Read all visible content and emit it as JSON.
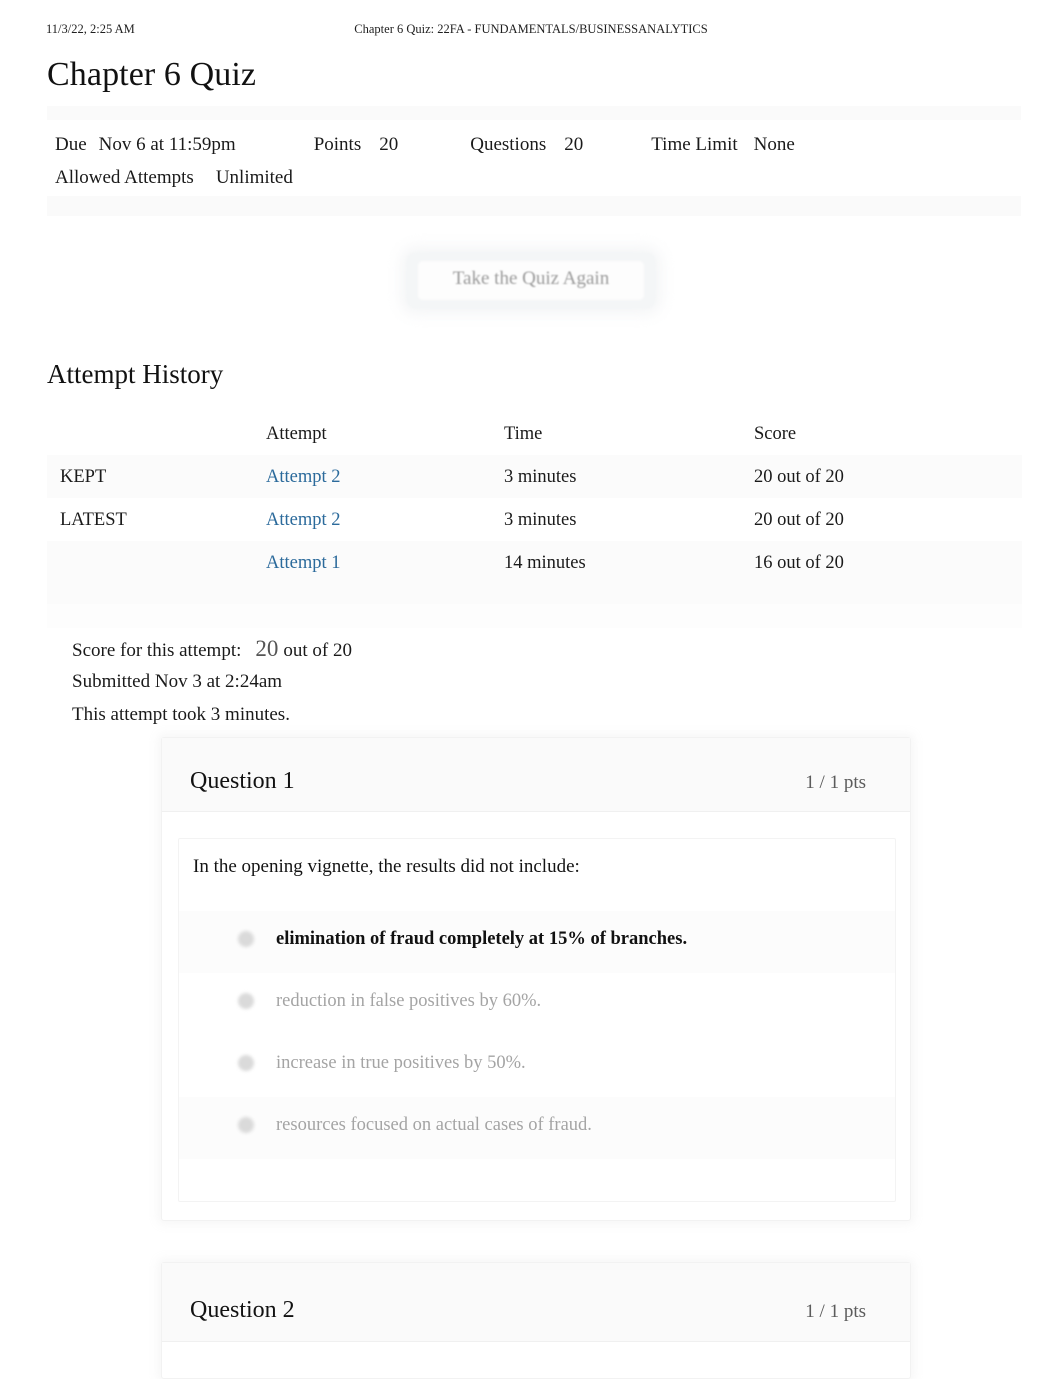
{
  "print_header": {
    "timestamp": "11/3/22, 2:25 AM",
    "document_title": "Chapter 6 Quiz: 22FA - FUNDAMENTALS/BUSINESSANALYTICS"
  },
  "page_title": "Chapter 6 Quiz",
  "quiz_details": {
    "due_label": "Due",
    "due_value": "Nov 6 at 11:59pm",
    "points_label": "Points",
    "points_value": "20",
    "questions_label": "Questions",
    "questions_value": "20",
    "time_limit_label": "Time Limit",
    "time_limit_value": "None",
    "allowed_attempts_label": "Allowed Attempts",
    "allowed_attempts_value": "Unlimited"
  },
  "retake_button": {
    "label": "Take the Quiz Again"
  },
  "attempt_history": {
    "title": "Attempt History",
    "columns": {
      "status": "",
      "attempt": "Attempt",
      "time": "Time",
      "score": "Score"
    },
    "rows": [
      {
        "status": "KEPT",
        "attempt": "Attempt 2",
        "time": "3 minutes",
        "score": "20 out of 20"
      },
      {
        "status": "LATEST",
        "attempt": "Attempt 2",
        "time": "3 minutes",
        "score": "20 out of 20"
      },
      {
        "status": "",
        "attempt": "Attempt 1",
        "time": "14 minutes",
        "score": "16 out of 20"
      }
    ]
  },
  "score_summary": {
    "score_label": "Score for this attempt:",
    "score_value": "20",
    "score_out_of": "out of 20",
    "submitted": "Submitted Nov 3 at 2:24am",
    "duration": "This attempt took 3 minutes."
  },
  "questions": [
    {
      "title": "Question 1",
      "points": "1 / 1 pts",
      "text": "In the opening vignette, the results did not include:",
      "answers": [
        {
          "text": "elimination of fraud completely at 15% of branches.",
          "selected": true
        },
        {
          "text": "reduction in false positives by 60%.",
          "selected": false
        },
        {
          "text": "increase in true positives by 50%.",
          "selected": false
        },
        {
          "text": "resources focused on actual cases of fraud.",
          "selected": false
        }
      ]
    },
    {
      "title": "Question 2",
      "points": "1 / 1 pts",
      "text": "",
      "answers": []
    }
  ],
  "colors": {
    "link": "#2b6a9b",
    "text": "#1a1a1a",
    "muted": "#a4a4a4",
    "band": "#fafafa"
  }
}
